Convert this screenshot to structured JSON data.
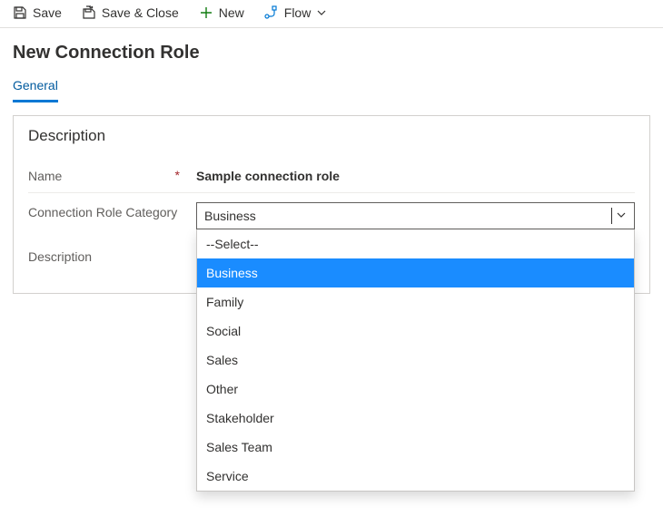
{
  "toolbar": {
    "save_label": "Save",
    "save_close_label": "Save & Close",
    "new_label": "New",
    "flow_label": "Flow"
  },
  "page": {
    "title": "New Connection Role"
  },
  "tabs": [
    {
      "label": "General",
      "active": true
    }
  ],
  "section": {
    "title": "Description",
    "fields": {
      "name_label": "Name",
      "name_value": "Sample connection role",
      "name_required": "*",
      "category_label": "Connection Role Category",
      "category_value": "Business",
      "description_label": "Description",
      "description_value": ""
    },
    "category_options": [
      "--Select--",
      "Business",
      "Family",
      "Social",
      "Sales",
      "Other",
      "Stakeholder",
      "Sales Team",
      "Service"
    ],
    "category_selected_index": 1
  },
  "colors": {
    "accent": "#0078d4",
    "highlight": "#1a8cff"
  }
}
